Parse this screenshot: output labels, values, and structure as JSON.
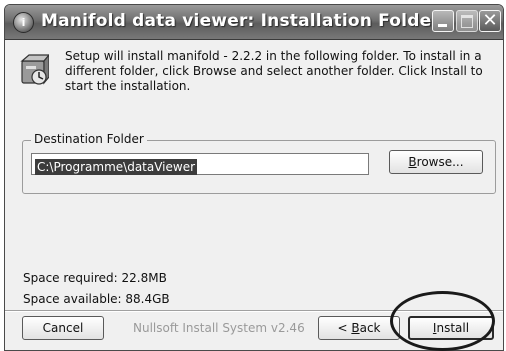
{
  "window": {
    "title": "Manifold data viewer: Installation Folder",
    "app_icon": "nsis-setup-icon",
    "minimize_icon": "minimize-icon",
    "maximize_icon": "maximize-icon",
    "close_icon": "close-icon",
    "close_glyph": "✕"
  },
  "intro": {
    "icon": "installer-box-icon",
    "text": "Setup will install manifold - 2.2.2 in the following folder. To install in a different folder, click Browse and select another folder. Click Install to start the installation."
  },
  "destination": {
    "legend": "Destination Folder",
    "path_value": "C:\\Programme\\dataViewer",
    "browse_prefix": "B",
    "browse_rest": "rowse..."
  },
  "space": {
    "required": "Space required: 22.8MB",
    "available": "Space available: 88.4GB"
  },
  "footer": {
    "cancel_label": "Cancel",
    "branding": "Nullsoft Install System v2.46",
    "back_prefix": "< ",
    "back_accel": "B",
    "back_rest": "ack",
    "install_accel": "I",
    "install_rest": "nstall"
  },
  "colors": {
    "titlebar": "#6f6f6f",
    "dialog_bg": "#f0f0f0",
    "selection": "#3c3c3c"
  }
}
